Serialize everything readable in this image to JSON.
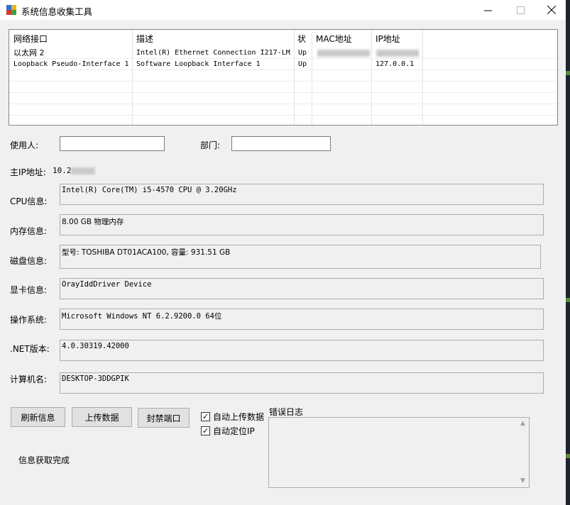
{
  "window": {
    "title": "系统信息收集工具"
  },
  "listview": {
    "columns": [
      "网络接口",
      "描述",
      "状",
      "MAC地址",
      "IP地址"
    ],
    "rows": [
      [
        "以太网 2",
        "Intel(R) Ethernet Connection I217-LM",
        "Up",
        "",
        ""
      ],
      [
        "Loopback Pseudo-Interface 1",
        "Software Loopback Interface 1",
        "Up",
        "",
        "127.0.0.1"
      ]
    ]
  },
  "user": {
    "label": "使用人:",
    "value": ""
  },
  "dept": {
    "label": "部门:",
    "value": ""
  },
  "main_ip": {
    "label": "主IP地址:",
    "value": "10.2"
  },
  "fields": [
    {
      "label": "CPU信息:",
      "value": "Intel(R) Core(TM) i5-4570 CPU @ 3.20GHz"
    },
    {
      "label": "内存信息:",
      "value": "8.00 GB 物理内存"
    },
    {
      "label": "磁盘信息:",
      "value": "型号: TOSHIBA DT01ACA100, 容量: 931.51 GB"
    },
    {
      "label": "显卡信息:",
      "value": "OrayIddDriver Device"
    },
    {
      "label": "操作系统:",
      "value": "Microsoft Windows NT 6.2.9200.0 64位"
    },
    {
      "label": ".NET版本:",
      "value": "4.0.30319.42000"
    },
    {
      "label": "计算机名:",
      "value": "DESKTOP-3DDGPIK"
    }
  ],
  "buttons": {
    "refresh": "刷新信息",
    "upload": "上传数据",
    "block": "封禁端口"
  },
  "checkboxes": {
    "auto_upload": {
      "label": "自动上传数据",
      "checked": true,
      "mark": "✓"
    },
    "auto_locate": {
      "label": "自动定位IP",
      "checked": true,
      "mark": "✓"
    }
  },
  "log": {
    "label": "错误日志"
  },
  "status": "信息获取完成"
}
